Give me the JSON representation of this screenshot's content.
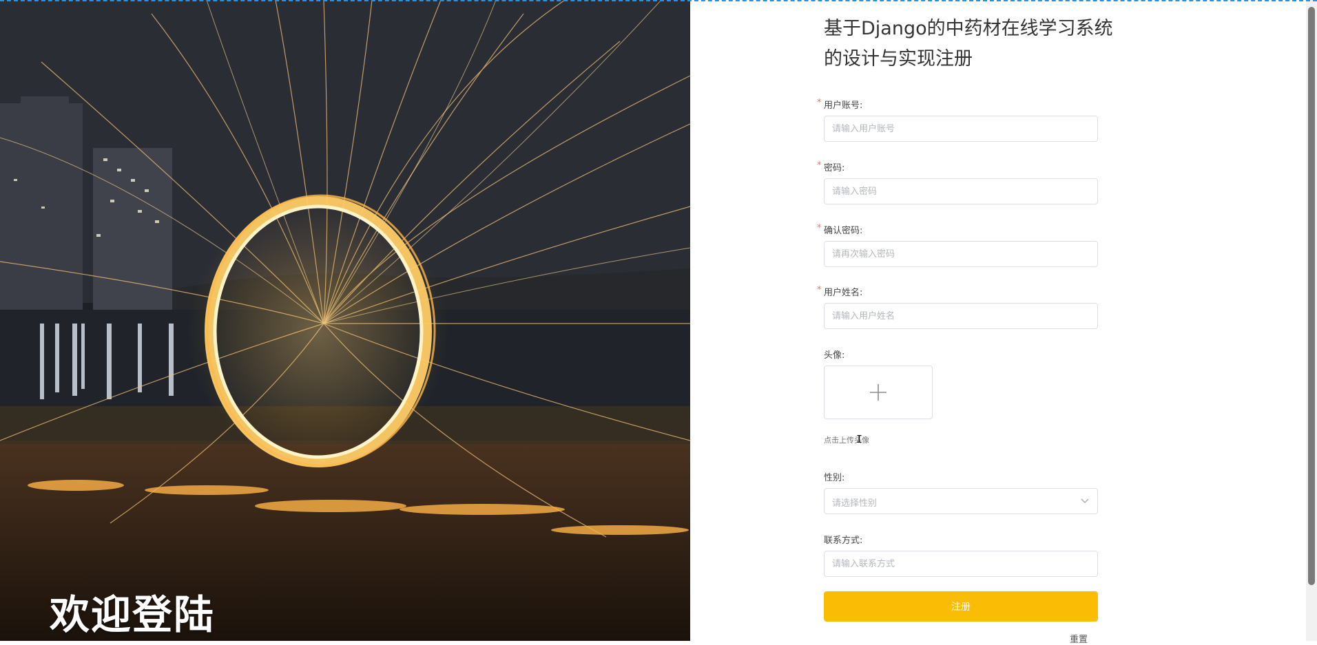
{
  "hero": {
    "caption": "欢迎登陆"
  },
  "form": {
    "title_line1": "基于Django的中药材在线学习系统",
    "title_line2": "的设计与实现注册",
    "required_mark": "*",
    "fields": {
      "account": {
        "label": "用户账号:",
        "placeholder": "请输入用户账号",
        "value": ""
      },
      "password": {
        "label": "密码:",
        "placeholder": "请输入密码",
        "value": ""
      },
      "confirm_password": {
        "label": "确认密码:",
        "placeholder": "请再次输入密码",
        "value": ""
      },
      "name": {
        "label": "用户姓名:",
        "placeholder": "请输入用户姓名",
        "value": ""
      },
      "avatar": {
        "label": "头像:",
        "hint": "点击上传头像"
      },
      "gender": {
        "label": "性别:",
        "placeholder": "请选择性别"
      },
      "contact": {
        "label": "联系方式:",
        "placeholder": "请输入联系方式",
        "value": ""
      }
    },
    "submit_label": "注册",
    "reset_label": "重置"
  },
  "colors": {
    "accent": "#fbbc05",
    "required": "#f56c6c",
    "border": "#dcdfe6",
    "placeholder": "#b4b7bd"
  },
  "icons": {
    "upload": "plus-icon",
    "select": "chevron-down-icon",
    "pointer": "text-cursor-icon"
  }
}
